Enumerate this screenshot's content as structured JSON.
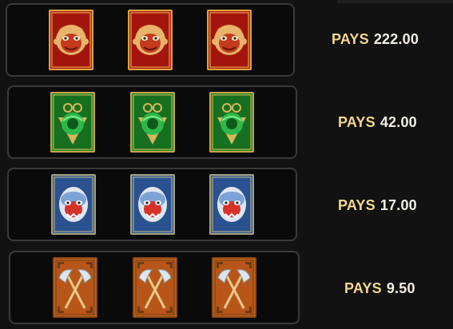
{
  "paytable": {
    "rows": [
      {
        "symbol_icon": "monkey-king-mask-icon",
        "symbol_color": "#b81f12",
        "count": 3,
        "pays_label": "PAYS",
        "amount": "222.00"
      },
      {
        "symbol_icon": "jade-dragon-pendant-icon",
        "symbol_color": "#1f8a2a",
        "count": 3,
        "pays_label": "PAYS",
        "amount": "42.00"
      },
      {
        "symbol_icon": "blue-demon-mask-icon",
        "symbol_color": "#2f5d9c",
        "count": 3,
        "pays_label": "PAYS",
        "amount": "17.00"
      },
      {
        "symbol_icon": "crossed-axes-icon",
        "symbol_color": "#c4621a",
        "count": 3,
        "pays_label": "PAYS",
        "amount": "9.50"
      }
    ]
  }
}
